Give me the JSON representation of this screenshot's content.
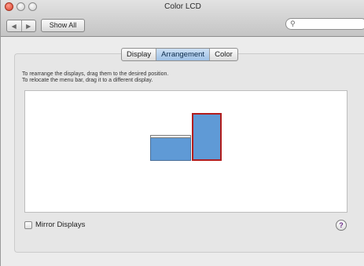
{
  "window": {
    "title": "Color LCD"
  },
  "toolbar": {
    "back_glyph": "◀",
    "forward_glyph": "▶",
    "show_all_label": "Show All",
    "search_icon": "⚲",
    "search_placeholder": ""
  },
  "tabs": [
    {
      "label": "Display",
      "active": false
    },
    {
      "label": "Arrangement",
      "active": true
    },
    {
      "label": "Color",
      "active": false
    }
  ],
  "instructions": {
    "line1": "To rearrange the displays, drag them to the desired position.",
    "line2": "To relocate the menu bar, drag it to a different display."
  },
  "arrangement": {
    "display_color": "#5f9ad6",
    "selected_border_color": "#b21d1d"
  },
  "mirror": {
    "label": "Mirror Displays",
    "checked": false
  },
  "help": {
    "glyph": "?"
  }
}
